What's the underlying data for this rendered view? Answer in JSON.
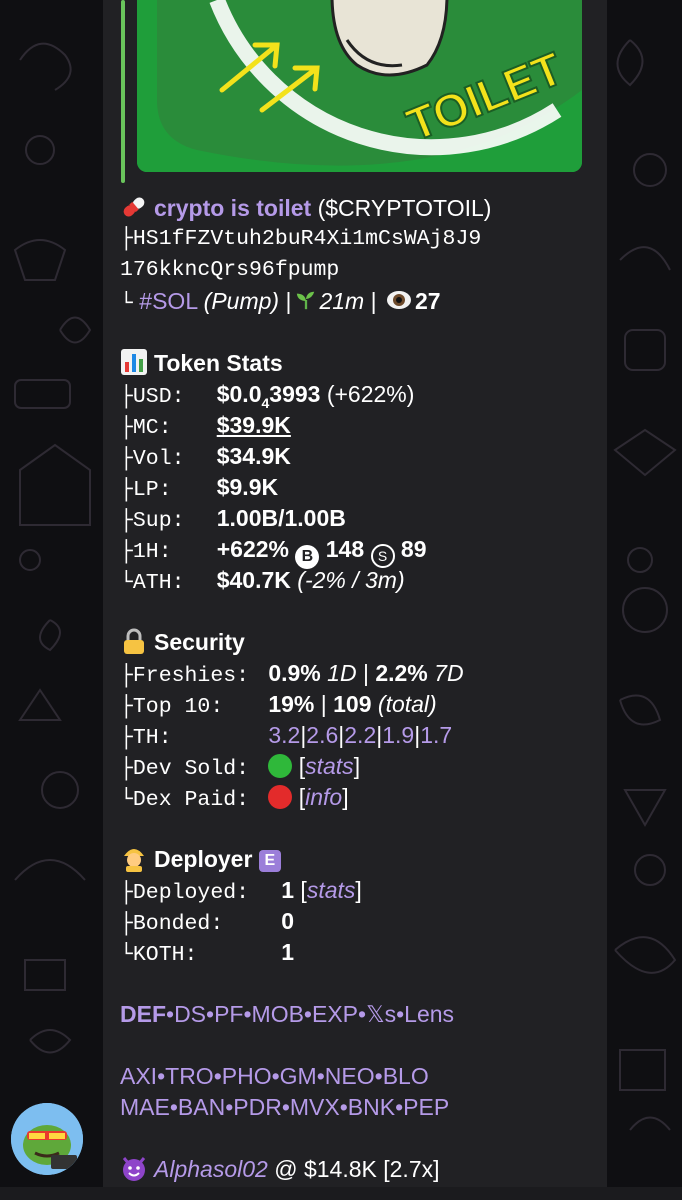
{
  "colors": {
    "background": "#0f0f12",
    "bubble": "#212124",
    "link": "#b59ae8",
    "media_green": "#1f9e3a",
    "accent_bar": "#6ac45c"
  },
  "media": {
    "label": "TOILET"
  },
  "token": {
    "pill_icon": "pill-icon",
    "name": "crypto is toilet",
    "ticker": "($CRYPTOTOIL)",
    "address_prefix": "├",
    "address_line1": "HS1fFZVtuh2buR4Xi1mCsWAj8J9",
    "address_line2": "176kkncQrs96fpump",
    "chain_prefix": "└",
    "chain": "#SOL",
    "platform": "(Pump)",
    "sep": "|",
    "age_icon": "seedling-icon",
    "age": "21m",
    "views_icon": "eye-icon",
    "views": "27"
  },
  "stats": {
    "title": "Token Stats",
    "icon": "bar-chart-icon",
    "rows": {
      "usd": {
        "tree": "├",
        "label": "USD:  ",
        "val_a": "$0.0",
        "val_sub": "4",
        "val_b": "3993",
        "change": "(+622%)"
      },
      "mc": {
        "tree": "├",
        "label": "MC:   ",
        "value": "$39.9K"
      },
      "vol": {
        "tree": "├",
        "label": "Vol:  ",
        "value": "$34.9K"
      },
      "lp": {
        "tree": "├",
        "label": "LP:   ",
        "value": "$9.9K"
      },
      "sup": {
        "tree": "├",
        "label": "Sup:  ",
        "value": "1.00B/1.00B"
      },
      "h1": {
        "tree": "├",
        "label": "1H:   ",
        "pct": "+622%",
        "buy_icon": "B",
        "buys": "148",
        "sell_icon": "S",
        "sells": "89"
      },
      "ath": {
        "tree": "└",
        "label": "ATH:  ",
        "value": "$40.7K",
        "detail": "(-2% / 3m)"
      }
    }
  },
  "security": {
    "title": "Security",
    "icon": "lock-icon",
    "rows": {
      "freshies": {
        "tree": "├",
        "label": "Freshies: ",
        "v1": "0.9%",
        "p1": "1D",
        "sep": "|",
        "v2": "2.2%",
        "p2": "7D"
      },
      "top10": {
        "tree": "├",
        "label": "Top 10:   ",
        "v1": "19%",
        "sep": "|",
        "v2": "109",
        "p": "(total)"
      },
      "th": {
        "tree": "├",
        "label": "TH:       ",
        "values": [
          "3.2",
          "2.6",
          "2.2",
          "1.9",
          "1.7"
        ]
      },
      "dev_sold": {
        "tree": "├",
        "label": "Dev Sold: ",
        "status": "green-circle-icon",
        "link": "stats"
      },
      "dex_paid": {
        "tree": "└",
        "label": "Dex Paid: ",
        "status": "red-circle-icon",
        "link": "info"
      }
    }
  },
  "deployer": {
    "title": "Deployer",
    "badge": "E",
    "icon": "worker-icon",
    "rows": {
      "deployed": {
        "tree": "├",
        "label": "Deployed:  ",
        "value": "1",
        "link": "stats"
      },
      "bonded": {
        "tree": "├",
        "label": "Bonded:    ",
        "value": "0"
      },
      "koth": {
        "tree": "└",
        "label": "KOTH:      ",
        "value": "1"
      }
    }
  },
  "links_row1": [
    "DEF",
    "DS",
    "PF",
    "MOB",
    "EXP",
    "𝕏s",
    "Lens"
  ],
  "links_row2": [
    "AXI",
    "TRO",
    "PHO",
    "GM",
    "NEO",
    "BLO"
  ],
  "links_row3": [
    "MAE",
    "BAN",
    "PDR",
    "MVX",
    "BNK",
    "PEP"
  ],
  "dot": "•",
  "caller": {
    "icon": "devil-icon",
    "name": "Alphasol02",
    "at": "@",
    "value": "$14.8K",
    "multiple": "[2.7x]"
  }
}
